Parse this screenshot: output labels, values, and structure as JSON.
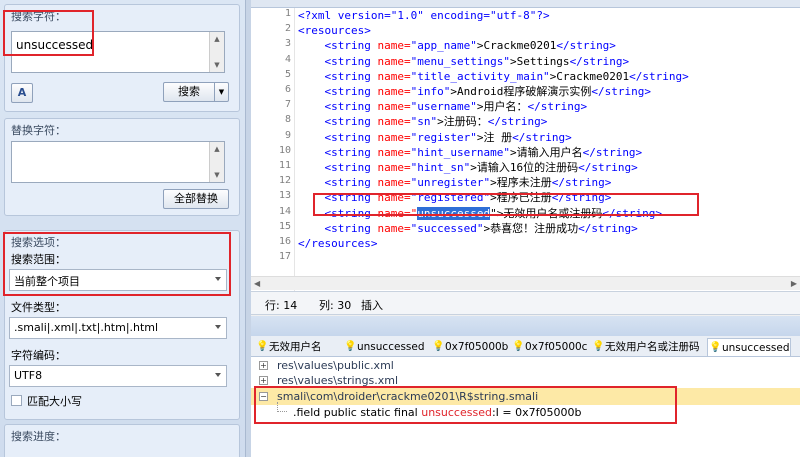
{
  "left_panel": {
    "search": {
      "title": "搜索字符：",
      "value": "unsuccessed",
      "search_button": "搜索",
      "case_icon": "font-case-icon"
    },
    "replace": {
      "title": "替换字符：",
      "value": "",
      "replace_all_button": "全部替换"
    },
    "options": {
      "title": "搜索选项：",
      "scope_label": "搜索范围：",
      "scope_value": "当前整个项目",
      "filetype_label": "文件类型：",
      "filetype_value": ".smali|.xml|.txt|.htm|.html",
      "encoding_label": "字符编码：",
      "encoding_value": "UTF8",
      "match_case_label": "匹配大小写",
      "match_case_checked": false
    },
    "progress": {
      "title": "搜索进度："
    }
  },
  "editor": {
    "line_numbers": [
      "1",
      "2",
      "3",
      "4",
      "5",
      "6",
      "7",
      "8",
      "9",
      "10",
      "11",
      "12",
      "13",
      "14",
      "15",
      "16",
      "17"
    ],
    "lines": [
      {
        "a": "<?xml version=\"1.0\" encoding=\"utf-8\"?>",
        "b": "",
        "c": "",
        "d": "",
        "e": ""
      },
      {
        "a": "<resources>",
        "b": "",
        "c": "",
        "d": "",
        "e": ""
      },
      {
        "a": "    <string ",
        "b": "name=",
        "c": "\"app_name\"",
        "d": ">Crackme0201",
        "e": "</string>"
      },
      {
        "a": "    <string ",
        "b": "name=",
        "c": "\"menu_settings\"",
        "d": ">Settings",
        "e": "</string>"
      },
      {
        "a": "    <string ",
        "b": "name=",
        "c": "\"title_activity_main\"",
        "d": ">Crackme0201",
        "e": "</string>"
      },
      {
        "a": "    <string ",
        "b": "name=",
        "c": "\"info\"",
        "d": ">Android程序破解演示实例",
        "e": "</string>"
      },
      {
        "a": "    <string ",
        "b": "name=",
        "c": "\"username\"",
        "d": ">用户名：",
        "e": "</string>"
      },
      {
        "a": "    <string ",
        "b": "name=",
        "c": "\"sn\"",
        "d": ">注册码：",
        "e": "</string>"
      },
      {
        "a": "    <string ",
        "b": "name=",
        "c": "\"register\"",
        "d": ">注 册",
        "e": "</string>"
      },
      {
        "a": "    <string ",
        "b": "name=",
        "c": "\"hint_username\"",
        "d": ">请输入用户名",
        "e": "</string>"
      },
      {
        "a": "    <string ",
        "b": "name=",
        "c": "\"hint_sn\"",
        "d": ">请输入16位的注册码",
        "e": "</string>"
      },
      {
        "a": "    <string ",
        "b": "name=",
        "c": "\"unregister\"",
        "d": ">程序未注册",
        "e": "</string>"
      },
      {
        "a": "    <string ",
        "b": "name=",
        "c": "\"registered\"",
        "d": ">程序已注册",
        "e": "</string>"
      },
      {
        "a": "    <string ",
        "b": "name=\"",
        "c": "unsuccessed",
        "d": "\">无效用户名或注册码",
        "e": "</string>"
      },
      {
        "a": "    <string ",
        "b": "name=",
        "c": "\"successed\"",
        "d": ">恭喜您！注册成功",
        "e": "</string>"
      },
      {
        "a": "</resources>",
        "b": "",
        "c": "",
        "d": "",
        "e": ""
      },
      {
        "a": "",
        "b": "",
        "c": "",
        "d": "",
        "e": ""
      }
    ]
  },
  "status": {
    "line": "行: 14",
    "col": "列: 30",
    "mode": "插入"
  },
  "result_tabs": [
    "无效用户名",
    "unsuccessed",
    "0x7f05000b",
    "0x7f05000c",
    "无效用户名或注册码",
    "unsuccessed"
  ],
  "results": [
    {
      "expander": "+",
      "text": "res\\values\\public.xml"
    },
    {
      "expander": "+",
      "text": "res\\values\\strings.xml"
    },
    {
      "expander": "−",
      "text": "smali\\com\\droider\\crackme0201\\R$string.smali"
    }
  ],
  "result_detail": {
    "before": ".field public static final ",
    "hit": "unsuccessed",
    "after": ":I = 0x7f05000b"
  },
  "colors": {
    "highlight_red": "#e0242b",
    "selected_row": "#fde9a6",
    "xml_tag": "#0000ff",
    "xml_attr": "#ff0000"
  }
}
